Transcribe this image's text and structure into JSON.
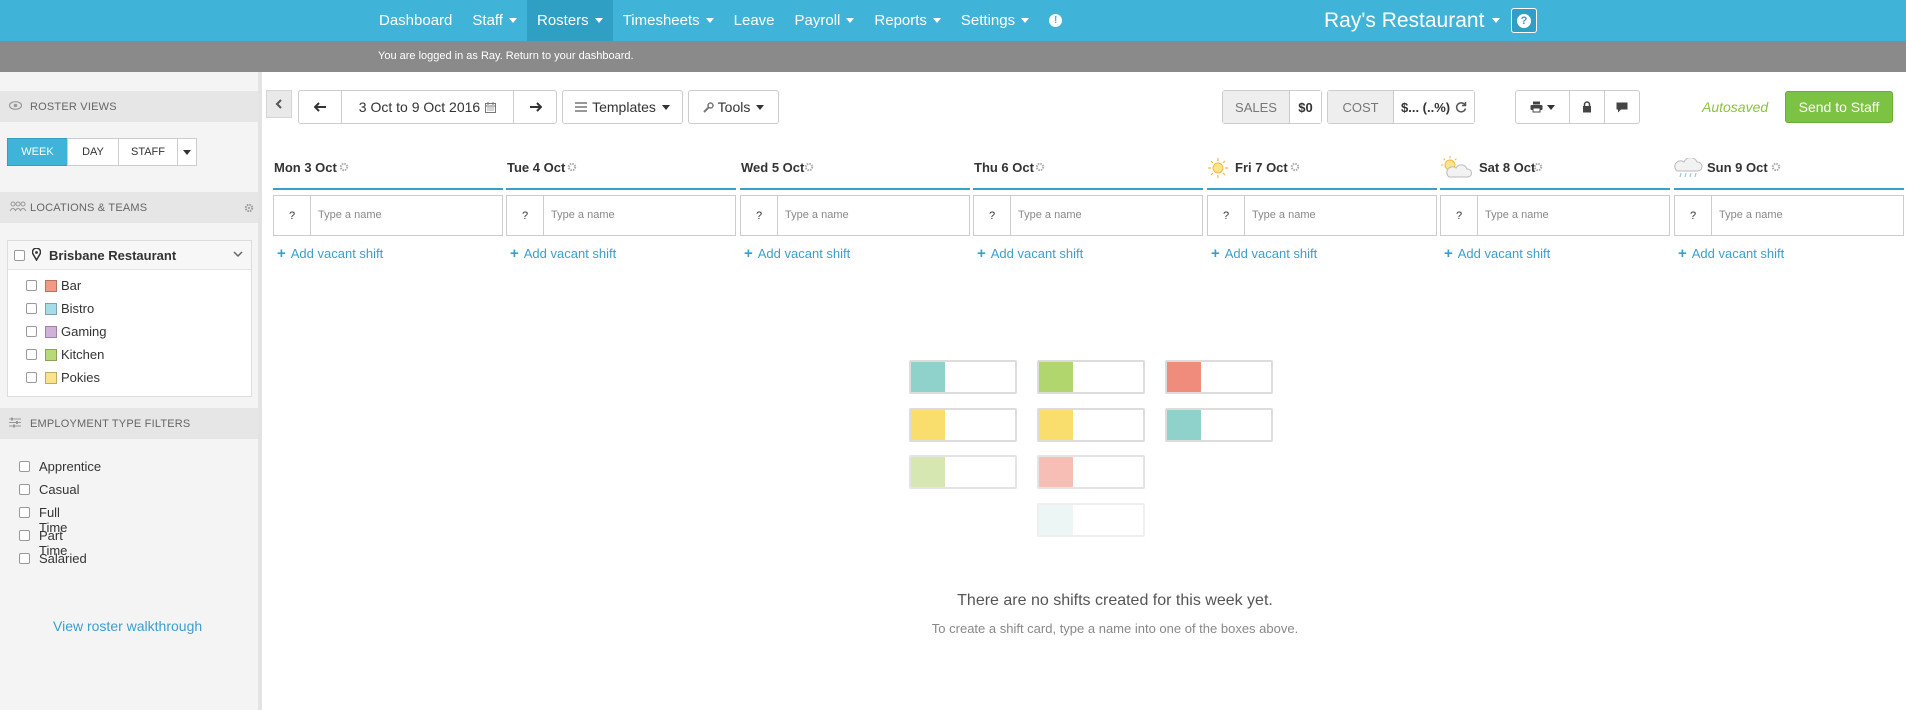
{
  "nav": {
    "items": [
      {
        "label": "Dashboard",
        "dropdown": false
      },
      {
        "label": "Staff",
        "dropdown": true
      },
      {
        "label": "Rosters",
        "dropdown": true,
        "active": true
      },
      {
        "label": "Timesheets",
        "dropdown": true
      },
      {
        "label": "Leave",
        "dropdown": false
      },
      {
        "label": "Payroll",
        "dropdown": true
      },
      {
        "label": "Reports",
        "dropdown": true
      },
      {
        "label": "Settings",
        "dropdown": true
      }
    ],
    "info_icon": "info-circle-icon",
    "brand": "Ray's Restaurant",
    "help_icon": "question-icon"
  },
  "logged_bar": {
    "text": "You are logged in as Ray. Return to your dashboard."
  },
  "sidebar": {
    "roster_views_title": "ROSTER VIEWS",
    "view_tabs": [
      "WEEK",
      "DAY",
      "STAFF"
    ],
    "active_view": "WEEK",
    "locations_title": "LOCATIONS & TEAMS",
    "location_name": "Brisbane Restaurant",
    "teams": [
      {
        "name": "Bar",
        "color": "#f29a86"
      },
      {
        "name": "Bistro",
        "color": "#a7dbe8"
      },
      {
        "name": "Gaming",
        "color": "#d2b1d9"
      },
      {
        "name": "Kitchen",
        "color": "#b7d97a"
      },
      {
        "name": "Pokies",
        "color": "#fbe38b"
      }
    ],
    "employment_title": "EMPLOYMENT TYPE FILTERS",
    "employment_types": [
      "Apprentice",
      "Casual",
      "Full Time",
      "Part Time",
      "Salaried"
    ],
    "walkthrough_link": "View roster walkthrough"
  },
  "toolbar": {
    "date_range": "3 Oct to 9 Oct 2016",
    "templates_label": "Templates",
    "tools_label": "Tools",
    "sales_label": "SALES",
    "sales_value": "$0",
    "cost_label": "COST",
    "cost_value": "$... (..%)",
    "autosaved": "Autosaved",
    "send_label": "Send to Staff"
  },
  "days": [
    {
      "label": "Mon 3 Oct",
      "weather": ""
    },
    {
      "label": "Tue 4 Oct",
      "weather": ""
    },
    {
      "label": "Wed 5 Oct",
      "weather": ""
    },
    {
      "label": "Thu 6 Oct",
      "weather": ""
    },
    {
      "label": "Fri 7 Oct",
      "weather": "sunny-icon"
    },
    {
      "label": "Sat 8 Oct",
      "weather": "partly-cloudy-icon"
    },
    {
      "label": "Sun 9 Oct",
      "weather": "rain-cloud-icon"
    }
  ],
  "day_input": {
    "question": "?",
    "placeholder": "Type a name"
  },
  "add_vacant": "Add vacant shift",
  "empty_state": {
    "title": "There are no shifts created for this week yet.",
    "subtitle": "To create a shift card, type a name into one of the boxes above."
  },
  "illustration_colors": [
    "#8fd1cb",
    "#b2d66e",
    "#f08c7c",
    "#f9de6e",
    "#f9de6e",
    "#8fd1cb",
    "#c9df97",
    "#f4a99b",
    "#d3ecea"
  ]
}
